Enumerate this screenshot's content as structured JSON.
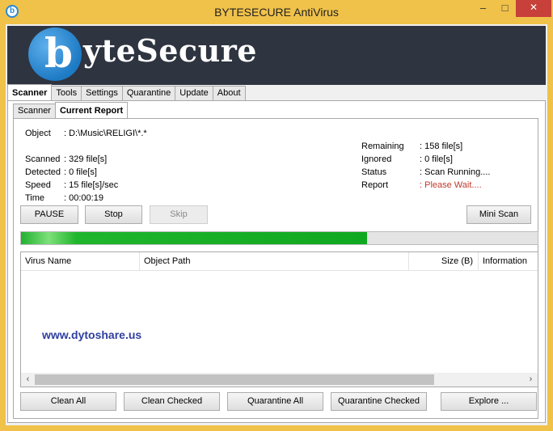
{
  "window": {
    "title": "BYTESECURE AntiVirus",
    "app_icon": "b",
    "min": "–",
    "max": "□",
    "close": "✕"
  },
  "banner": {
    "logo_letter": "b",
    "logo_text": "yteSecure"
  },
  "main_tabs": [
    "Scanner",
    "Tools",
    "Settings",
    "Quarantine",
    "Update",
    "About"
  ],
  "sub_tabs": [
    "Scanner",
    "Current Report"
  ],
  "info_left": [
    {
      "key": "Object",
      "value": ": D:\\Music\\RELIGI\\*.*"
    },
    {
      "key": "",
      "value": ""
    },
    {
      "key": "Scanned",
      "value": ": 329 file[s]"
    },
    {
      "key": "Detected",
      "value": ": 0 file[s]"
    },
    {
      "key": "Speed",
      "value": ": 15 file[s]/sec"
    },
    {
      "key": "Time",
      "value": ": 00:00:19"
    }
  ],
  "info_right": [
    {
      "key": "Remaining",
      "value": ": 158 file[s]"
    },
    {
      "key": "Ignored",
      "value": ": 0 file[s]"
    },
    {
      "key": "Status",
      "value": ": Scan Running...."
    },
    {
      "key": "Report",
      "value": ": Please Wait...."
    }
  ],
  "buttons": {
    "pause": "PAUSE",
    "stop": "Stop",
    "skip": "Skip",
    "mini_scan": "Mini Scan"
  },
  "progress": {
    "fraction": 0.67
  },
  "table": {
    "columns": [
      "Virus Name",
      "Object Path",
      "Size (B)",
      "Information"
    ],
    "rows": [],
    "watermark": "www.dytoshare.us",
    "scroll_left": "‹",
    "scroll_right": "›"
  },
  "actions": [
    "Clean All",
    "Clean Checked",
    "Quarantine All",
    "Quarantine Checked",
    "Explore ..."
  ],
  "colors": {
    "title_bar": "#f0c24a",
    "close": "#c7403a",
    "banner": "#2e3440",
    "progress": "#10a820",
    "wait_text": "#c0392b"
  }
}
